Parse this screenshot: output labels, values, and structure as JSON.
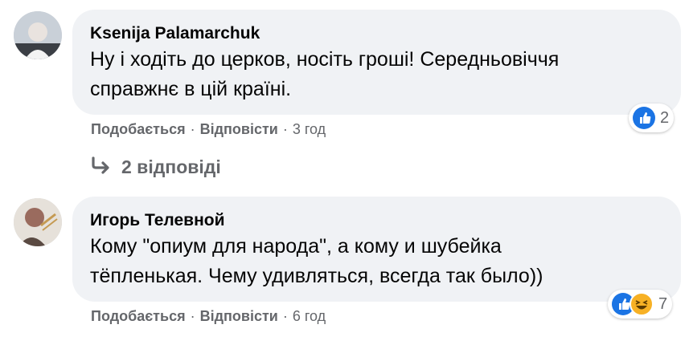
{
  "comments": [
    {
      "author": "Ksenija Palamarchuk",
      "line1": "Ну і ходіть до церков, носіть гроші! Середньовіччя",
      "line2": "справжнє в цій країні.",
      "like_label": "Подобається",
      "reply_label": "Відповісти",
      "time": "3 год",
      "reaction_count": "2",
      "reaction_icons": [
        "like-icon"
      ],
      "replies_label": "2 відповіді"
    },
    {
      "author": "Игорь Телевной",
      "line1": "Кому \"опиум для народа\", а кому и шубейка",
      "line2": "тёпленькая. Чему удивляться, всегда так было))",
      "like_label": "Подобається",
      "reply_label": "Відповісти",
      "time": "6 год",
      "reaction_count": "7",
      "reaction_icons": [
        "like-icon",
        "haha-icon"
      ]
    }
  ],
  "separator": "·",
  "colors": {
    "bubble": "#f0f2f5",
    "meta": "#65676b",
    "like": "#1b74e4",
    "haha": "#f7b125"
  }
}
